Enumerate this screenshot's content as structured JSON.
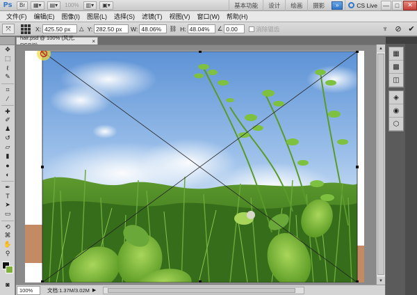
{
  "app": {
    "logo": "Ps",
    "zoom_value": "100%",
    "workspaces": [
      "基本功能",
      "设计",
      "绘画",
      "摄影"
    ],
    "more_label": "»",
    "cslive_label": "CS Live",
    "window_controls": [
      "—",
      "□",
      "✕"
    ]
  },
  "menu": [
    "文件(F)",
    "编辑(E)",
    "图像(I)",
    "图层(L)",
    "选择(S)",
    "滤镜(T)",
    "视图(V)",
    "窗口(W)",
    "帮助(H)"
  ],
  "options": {
    "x_label": "X:",
    "x_value": "425.50 px",
    "y_label": "Y:",
    "y_value": "282.50 px",
    "w_label": "W:",
    "w_value": "48.06%",
    "h_label": "H:",
    "h_value": "48.04%",
    "angle_label": "∠",
    "angle_value": "0.00",
    "h_skew_label": "H:",
    "antialias_label": "消除锯齿"
  },
  "document": {
    "tab_title": "hair.psd @ 100% (风光, RGB/8)",
    "tab_close": "×",
    "zoom": "100%",
    "doc_info": "文档:1.37M/3.02M"
  },
  "colors": {
    "foreground": "#111111",
    "background": "#7fb13a",
    "accent": "#2f76c8"
  },
  "tools": [
    "move-tool-icon",
    "marquee-tool-icon",
    "lasso-tool-icon",
    "quick-select-tool-icon",
    "crop-tool-icon",
    "eyedropper-tool-icon",
    "healing-brush-icon",
    "brush-tool-icon",
    "clone-stamp-icon",
    "history-brush-icon",
    "eraser-tool-icon",
    "gradient-tool-icon",
    "blur-tool-icon",
    "dodge-tool-icon",
    "pen-tool-icon",
    "type-tool-icon",
    "path-select-icon",
    "shape-tool-icon",
    "3d-rotate-icon",
    "3d-camera-icon",
    "hand-tool-icon",
    "zoom-tool-icon"
  ]
}
